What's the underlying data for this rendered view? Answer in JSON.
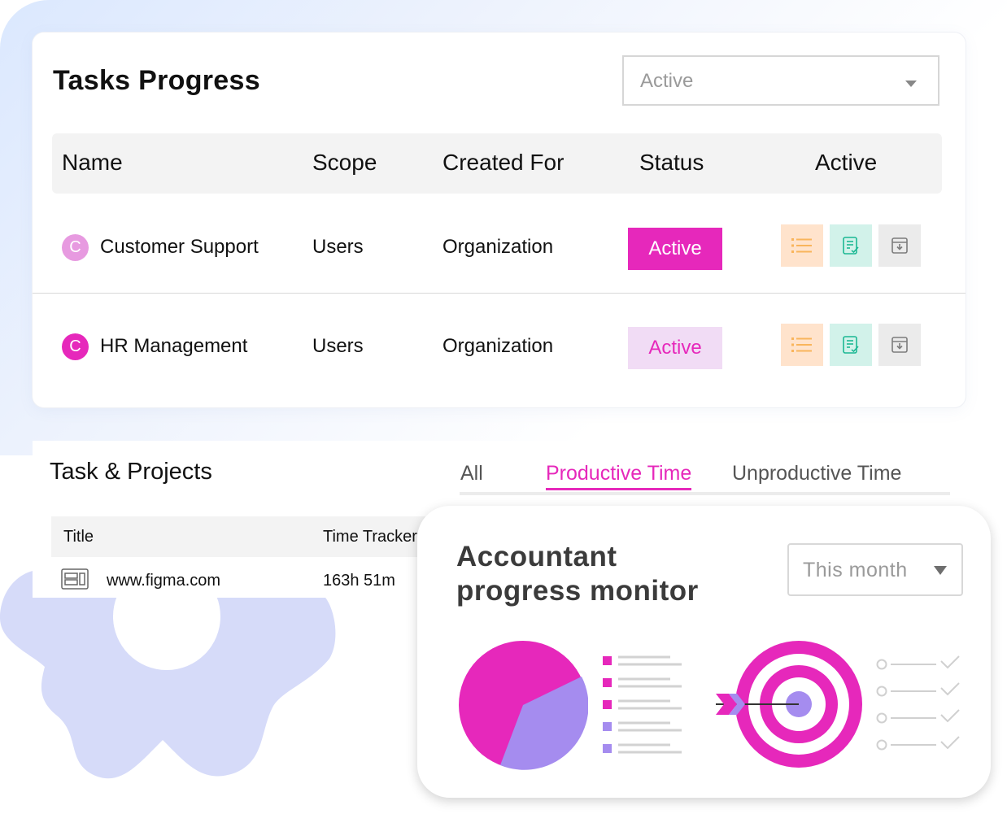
{
  "tasks_progress": {
    "title": "Tasks Progress",
    "filter": {
      "value": "Active"
    },
    "columns": [
      "Name",
      "Scope",
      "Created For",
      "Status",
      "Active"
    ],
    "rows": [
      {
        "initial": "C",
        "name": "Customer Support",
        "scope": "Users",
        "created_for": "Organization",
        "status": "Active",
        "avatar_color": "#e79ae0",
        "status_bg": "#e628bb",
        "status_color": "#ffffff"
      },
      {
        "initial": "C",
        "name": "HR Management",
        "scope": "Users",
        "created_for": "Organization",
        "status": "Active",
        "avatar_color": "#e628bb",
        "status_bg": "#f1dcf5",
        "status_color": "#e628bb"
      }
    ],
    "row_actions": [
      "list-icon",
      "notes-icon",
      "archive-icon"
    ]
  },
  "task_projects": {
    "title": "Task & Projects",
    "tabs": [
      "All",
      "Productive Time",
      "Unproductive Time"
    ],
    "active_tab": "Productive Time",
    "columns": [
      "Title",
      "Time Tracker"
    ],
    "rows": [
      {
        "title": "www.figma.com",
        "time": "163h 51m",
        "icon": "browser-window-icon"
      }
    ]
  },
  "monitor": {
    "title_line1": "Accountant",
    "title_line2": "progress monitor",
    "period": "This month"
  },
  "colors": {
    "accent": "#e628bb",
    "lavender": "#a58cef",
    "gear": "#d6dbf9"
  }
}
